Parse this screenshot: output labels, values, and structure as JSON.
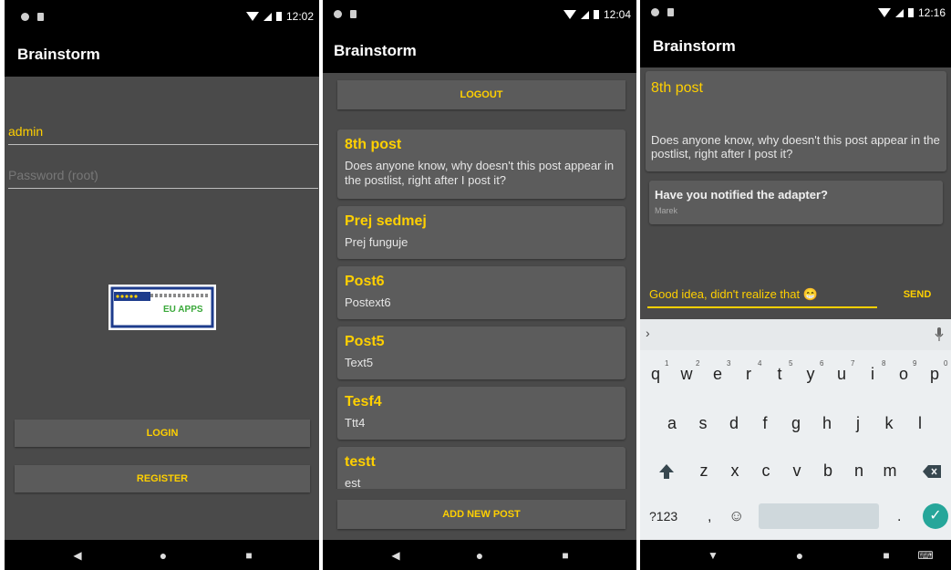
{
  "colors": {
    "accent": "#ffd000",
    "background": "#4a4a4a",
    "card": "#5c5c5c",
    "bar": "#000000"
  },
  "login_screen": {
    "status": {
      "time": "12:02"
    },
    "app_title": "Brainstorm",
    "username_value": "admin",
    "password_placeholder": "Password (root)",
    "logo_text": "EU APPS",
    "login_label": "LOGIN",
    "register_label": "REGISTER"
  },
  "list_screen": {
    "status": {
      "time": "12:04"
    },
    "app_title": "Brainstorm",
    "logout_label": "LOGOUT",
    "posts": [
      {
        "title": "8th post",
        "text": "Does anyone know, why doesn't this post appear in the postlist, right after I post it?"
      },
      {
        "title": "Prej sedmej",
        "text": "Prej funguje"
      },
      {
        "title": "Post6",
        "text": "Postext6"
      },
      {
        "title": "Post5",
        "text": "Text5"
      },
      {
        "title": "Tesf4",
        "text": "Ttt4"
      },
      {
        "title": "testt",
        "text": "est"
      }
    ],
    "add_post_label": "ADD NEW POST"
  },
  "detail_screen": {
    "status": {
      "time": "12:16"
    },
    "app_title": "Brainstorm",
    "post": {
      "title": "8th post",
      "text": "Does anyone know, why doesn't this post appear in the postlist, right after I post it?"
    },
    "comment": {
      "text": "Have you notified the adapter?",
      "author": "Marek"
    },
    "input_value": "Good idea, didn't realize that 😁",
    "send_label": "SEND",
    "keyboard": {
      "row1": [
        "q",
        "w",
        "e",
        "r",
        "t",
        "y",
        "u",
        "i",
        "o",
        "p"
      ],
      "row1_hints": [
        "1",
        "2",
        "3",
        "4",
        "5",
        "6",
        "7",
        "8",
        "9",
        "0"
      ],
      "row2": [
        "a",
        "s",
        "d",
        "f",
        "g",
        "h",
        "j",
        "k",
        "l"
      ],
      "row3": [
        "z",
        "x",
        "c",
        "v",
        "b",
        "n",
        "m"
      ],
      "mode_key": "?123",
      "comma": ",",
      "period": "."
    }
  },
  "icons": [
    "back-icon",
    "home-icon",
    "recents-icon",
    "wifi-icon",
    "signal-icon",
    "battery-icon",
    "shift-icon",
    "backspace-icon",
    "emoji-icon",
    "mic-icon",
    "chevron-right-icon",
    "check-icon",
    "keyboard-icon"
  ]
}
